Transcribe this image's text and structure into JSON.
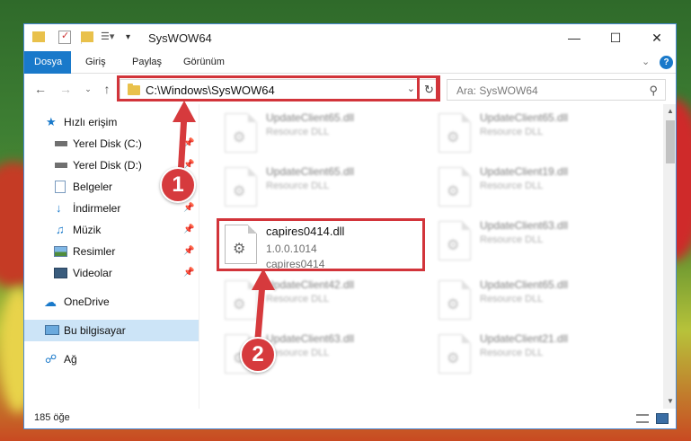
{
  "window": {
    "title": "SysWOW64"
  },
  "ribbon": {
    "tabs": [
      "Dosya",
      "Giriş",
      "Paylaş",
      "Görünüm"
    ]
  },
  "address": {
    "path": "C:\\Windows\\SysWOW64"
  },
  "search": {
    "placeholder": "Ara: SysWOW64"
  },
  "sidebar": {
    "items": [
      {
        "label": "Hızlı erişim",
        "icon": "star-icon",
        "pinned": false
      },
      {
        "label": "Yerel Disk (C:)",
        "icon": "drive-icon",
        "pinned": true
      },
      {
        "label": "Yerel Disk (D:)",
        "icon": "drive-icon",
        "pinned": true
      },
      {
        "label": "Belgeler",
        "icon": "documents-icon",
        "pinned": true
      },
      {
        "label": "İndirmeler",
        "icon": "download-icon",
        "pinned": true
      },
      {
        "label": "Müzik",
        "icon": "music-icon",
        "pinned": true
      },
      {
        "label": "Resimler",
        "icon": "pictures-icon",
        "pinned": true
      },
      {
        "label": "Videolar",
        "icon": "video-icon",
        "pinned": true
      },
      {
        "label": "OneDrive",
        "icon": "cloud-icon",
        "pinned": false
      },
      {
        "label": "Bu bilgisayar",
        "icon": "computer-icon",
        "pinned": false
      },
      {
        "label": "Ağ",
        "icon": "network-icon",
        "pinned": false
      }
    ]
  },
  "files": {
    "highlighted": {
      "name": "capires0414.dll",
      "version": "1.0.0.1014",
      "description": "capires0414"
    },
    "blurred": [
      {
        "name": "UpdateClient65.dll",
        "type": "Resource DLL"
      },
      {
        "name": "UpdateClient65.dll",
        "type": "Resource DLL"
      },
      {
        "name": "UpdateClient65.dll",
        "type": "Resource DLL"
      },
      {
        "name": "UpdateClient19.dll",
        "type": "Resource DLL"
      },
      {
        "name": "UpdateClient63.dll",
        "type": "Resource DLL"
      },
      {
        "name": "UpdateClient42.dll",
        "type": "Resource DLL"
      },
      {
        "name": "UpdateClient65.dll",
        "type": "Resource DLL"
      },
      {
        "name": "UpdateClient63.dll",
        "type": "Resource DLL"
      },
      {
        "name": "UpdateClient21.dll",
        "type": "Resource DLL"
      }
    ]
  },
  "status": {
    "count": "185 öğe"
  },
  "annotations": {
    "badge1": "1",
    "badge2": "2",
    "color": "#d63a3d"
  }
}
